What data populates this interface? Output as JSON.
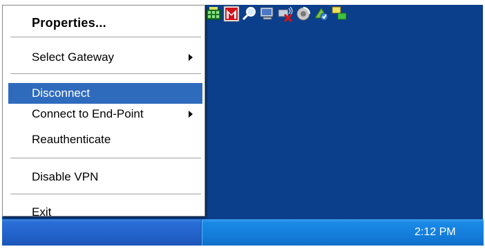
{
  "menu": {
    "properties": "Properties...",
    "select_gateway": "Select Gateway",
    "disconnect": "Disconnect",
    "connect_to_end_point": "Connect to End-Point",
    "reauthenticate": "Reauthenticate",
    "disable_vpn": "Disable VPN",
    "exit": "Exit"
  },
  "taskbar": {
    "clock": "2:12 PM"
  },
  "tray_icons": [
    "network-grid-icon",
    "mcafee-icon",
    "search-icon",
    "monitor-icon",
    "wireless-disconnected-icon",
    "volume-icon",
    "update-icon",
    "vpn-network-icon"
  ],
  "colors": {
    "desktop": "#0b3f8c",
    "highlight": "#2f6bbd",
    "taskbar": "#2262c9",
    "tray": "#137ad8"
  }
}
